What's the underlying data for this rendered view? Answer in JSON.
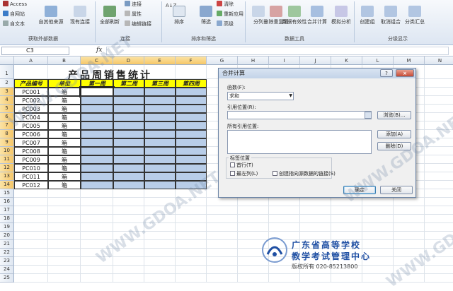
{
  "ribbon": {
    "get_external": {
      "access": "Access",
      "web": "自网站",
      "text": "自文本",
      "other": "自其他来源",
      "existing": "现有连接",
      "label": "获取外部数据"
    },
    "connections": {
      "refresh_all": "全部刷新",
      "connections": "连接",
      "properties": "属性",
      "edit_links": "编辑链接",
      "label": "连接"
    },
    "sort_filter": {
      "sort_az": "A↓Z",
      "sort": "排序",
      "filter": "筛选",
      "clear": "清除",
      "reapply": "重新应用",
      "advanced": "高级",
      "label": "排序和筛选"
    },
    "data_tools": {
      "text_to_columns": "分列",
      "remove_dup": "删除重复项",
      "validation": "数据有效性",
      "consolidate": "合并计算",
      "whatif": "模拟分析",
      "label": "数据工具"
    },
    "outline": {
      "group": "创建组",
      "ungroup": "取消组合",
      "subtotal": "分类汇总",
      "label": "分级显示"
    }
  },
  "formula_bar": {
    "name_box": "C3",
    "fx": "fx",
    "formula": ""
  },
  "sheet": {
    "columns": [
      "A",
      "B",
      "C",
      "D",
      "E",
      "F",
      "G",
      "H",
      "I",
      "J",
      "K",
      "L",
      "M",
      "N"
    ],
    "rows": [
      "1",
      "2",
      "3",
      "4",
      "5",
      "6",
      "7",
      "8",
      "9",
      "10",
      "11",
      "12",
      "13",
      "14",
      "15",
      "16",
      "17",
      "18",
      "19",
      "20",
      "21",
      "22",
      "23",
      "24",
      "25"
    ],
    "title": "产品周销售统计",
    "headers": [
      "产品编号",
      "单位",
      "第一周",
      "第二周",
      "第三周",
      "第四周"
    ],
    "data": [
      [
        "PC001",
        "箱"
      ],
      [
        "PC002",
        "箱"
      ],
      [
        "PC003",
        "箱"
      ],
      [
        "PC004",
        "箱"
      ],
      [
        "PC005",
        "箱"
      ],
      [
        "PC006",
        "箱"
      ],
      [
        "PC007",
        "箱"
      ],
      [
        "PC008",
        "箱"
      ],
      [
        "PC009",
        "箱"
      ],
      [
        "PC010",
        "箱"
      ],
      [
        "PC011",
        "箱"
      ],
      [
        "PC012",
        "箱"
      ]
    ]
  },
  "dialog": {
    "title": "合并计算",
    "help": "?",
    "close": "×",
    "function_label": "函数(F):",
    "function_value": "求和",
    "ref_label": "引用位置(R):",
    "ref_value": "",
    "browse": "浏览(B)...",
    "all_refs_label": "所有引用位置:",
    "add": "添加(A)",
    "delete": "删除(D)",
    "label_pos": "标签位置",
    "first_row": "首行(T)",
    "left_col": "最左列(L)",
    "create_links": "创建指向源数据的链接(S)",
    "ok": "确定",
    "cancel": "关闭"
  },
  "watermark": {
    "text": "WWW.GDOA.NET",
    "org_line1": "广东省高等学校",
    "org_line2": "教学考试管理中心",
    "copyright": "版权所有 020-85213800"
  }
}
